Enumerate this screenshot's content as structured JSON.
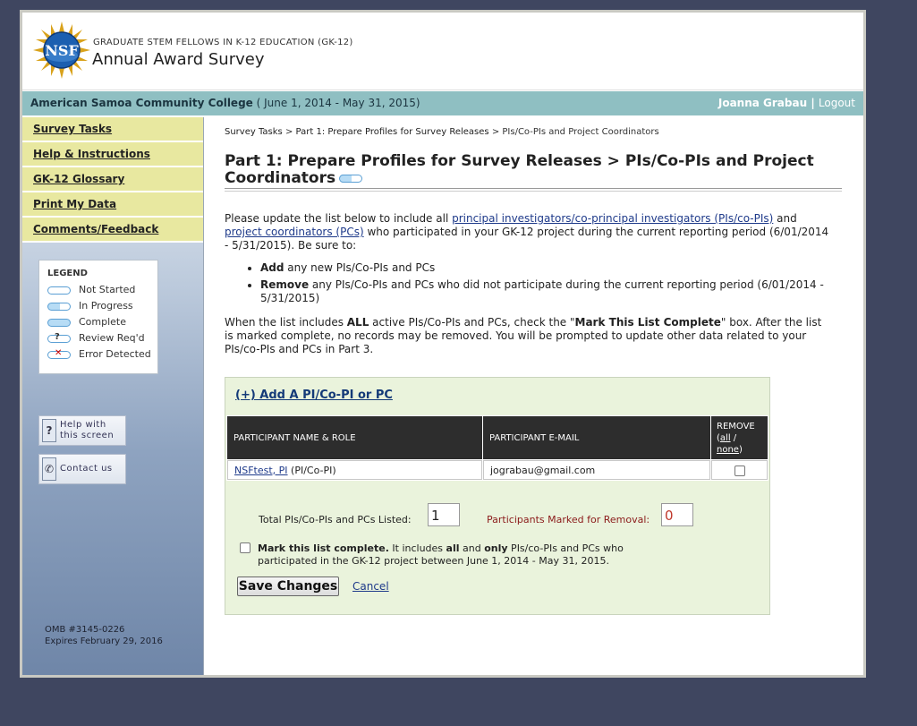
{
  "header": {
    "logo_text": "NSF",
    "subtitle": "GRADUATE STEM FELLOWS IN K-12 EDUCATION (GK-12)",
    "title": "Annual Award Survey"
  },
  "topbar": {
    "institution": "American Samoa Community College",
    "period": "( June 1, 2014 - May 31, 2015)",
    "user": "Joanna Grabau",
    "separator": "|",
    "logout": "Logout"
  },
  "sidebar": {
    "nav": [
      "Survey Tasks",
      "Help & Instructions",
      "GK-12 Glossary",
      "Print My Data",
      "Comments/Feedback"
    ],
    "legend": {
      "title": "LEGEND",
      "items": [
        "Not Started",
        "In Progress",
        "Complete",
        "Review Req'd",
        "Error Detected"
      ]
    },
    "help_button": {
      "line1": "Help with",
      "line2": "this screen",
      "icon": "?"
    },
    "contact_button": {
      "label": "Contact us"
    },
    "omb": "OMB #3145-0226",
    "expires": "Expires February 29, 2016"
  },
  "main": {
    "breadcrumb": [
      "Survey Tasks",
      "Part 1: Prepare Profiles for Survey Releases",
      "PIs/Co-PIs and Project Coordinators"
    ],
    "breadcrumb_sep": ">",
    "title_line1": "Part 1: Prepare Profiles for Survey Releases > PIs/Co-PIs and Project",
    "title_line2": "Coordinators",
    "intro": {
      "t1": "Please update the list below to include all ",
      "link1": "principal investigators/co-principal investigators (PIs/co-PIs)",
      "t2": " and ",
      "link2": "project coordinators (PCs)",
      "t3": " who participated in your GK-12 project during the current reporting period (6/01/2014 - 5/31/2015). Be sure to:"
    },
    "bullets": [
      {
        "bold": "Add",
        "rest": " any new PIs/Co-PIs and PCs"
      },
      {
        "bold": "Remove",
        "rest": " any PIs/Co-PIs and PCs who did not participate during the current reporting period (6/01/2014 - 5/31/2015)"
      }
    ],
    "note": {
      "t1": "When the list includes ",
      "b1": "ALL",
      "t2": " active PIs/Co-PIs and PCs, check the \"",
      "b2": "Mark This List Complete",
      "t3": "\" box. After the list is marked complete, no records may be removed. You will be prompted to update other data related to your PIs/co-PIs and PCs in Part 3."
    },
    "add_link": "(+) Add A PI/Co-PI or PC",
    "table": {
      "headers": [
        "PARTICIPANT NAME & ROLE",
        "PARTICIPANT E-MAIL"
      ],
      "remove_header": "REMOVE",
      "remove_all": "all",
      "remove_none": "none",
      "rows": [
        {
          "name": "NSFtest, PI",
          "role": " (PI/Co-PI)",
          "email": "jograbau@gmail.com"
        }
      ]
    },
    "total_label": "Total PIs/Co-PIs and PCs Listed:",
    "total_value": "1",
    "removal_label": "Participants Marked for Removal:",
    "removal_value": "0",
    "mark": {
      "b1": "Mark this list complete.",
      "t1": " It includes ",
      "b2": "all",
      "t2": " and ",
      "b3": "only",
      "t3": " PIs/co-PIs and PCs who participated in the GK-12 project between June 1, 2014 - May 31, 2015."
    },
    "save_label": "Save Changes",
    "cancel_label": "Cancel"
  }
}
